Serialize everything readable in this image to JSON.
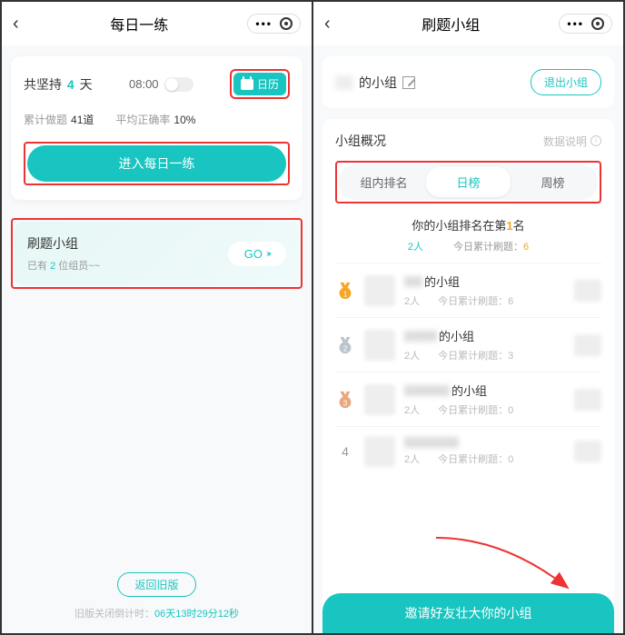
{
  "left": {
    "title": "每日一练",
    "persist_pre": "共坚持",
    "persist_days": "4",
    "persist_suf": "天",
    "time": "08:00",
    "calendar": "日历",
    "stat_q_label": "累计做题",
    "stat_q_val": "41道",
    "stat_r_label": "平均正确率",
    "stat_r_val": "10%",
    "enter": "进入每日一练",
    "group_title": "刷题小组",
    "group_sub_pre": "已有 ",
    "group_sub_n": "2",
    "group_sub_suf": " 位组员~~",
    "go": "GO",
    "old_btn": "返回旧版",
    "countdown_label": "旧版关闭倒计时：",
    "countdown_val": "06天13时29分12秒"
  },
  "right": {
    "title": "刷题小组",
    "name_suffix": "的小组",
    "quit": "退出小组",
    "ov_label": "小组概况",
    "ov_info": "数据说明",
    "tabs": [
      "组内排名",
      "日榜",
      "周榜"
    ],
    "your_rank_pre": "你的小组排名在第",
    "your_rank_n": "1",
    "your_rank_suf": "名",
    "your_people": "2人",
    "your_q_label": "今日累计刷题：",
    "your_q_n": "6",
    "list": [
      {
        "medal": 1,
        "name_suffix": "的小组",
        "people": "2人",
        "qlabel": "今日累计刷题：6"
      },
      {
        "medal": 2,
        "name_suffix": "的小组",
        "people": "2人",
        "qlabel": "今日累计刷题：3"
      },
      {
        "medal": 3,
        "name_suffix": "的小组",
        "people": "2人",
        "qlabel": "今日累计刷题：0"
      },
      {
        "medal": 0,
        "rank": "4",
        "name_suffix": "",
        "people": "2人",
        "qlabel": "今日累计刷题：0"
      }
    ],
    "invite": "邀请好友壮大你的小组"
  }
}
